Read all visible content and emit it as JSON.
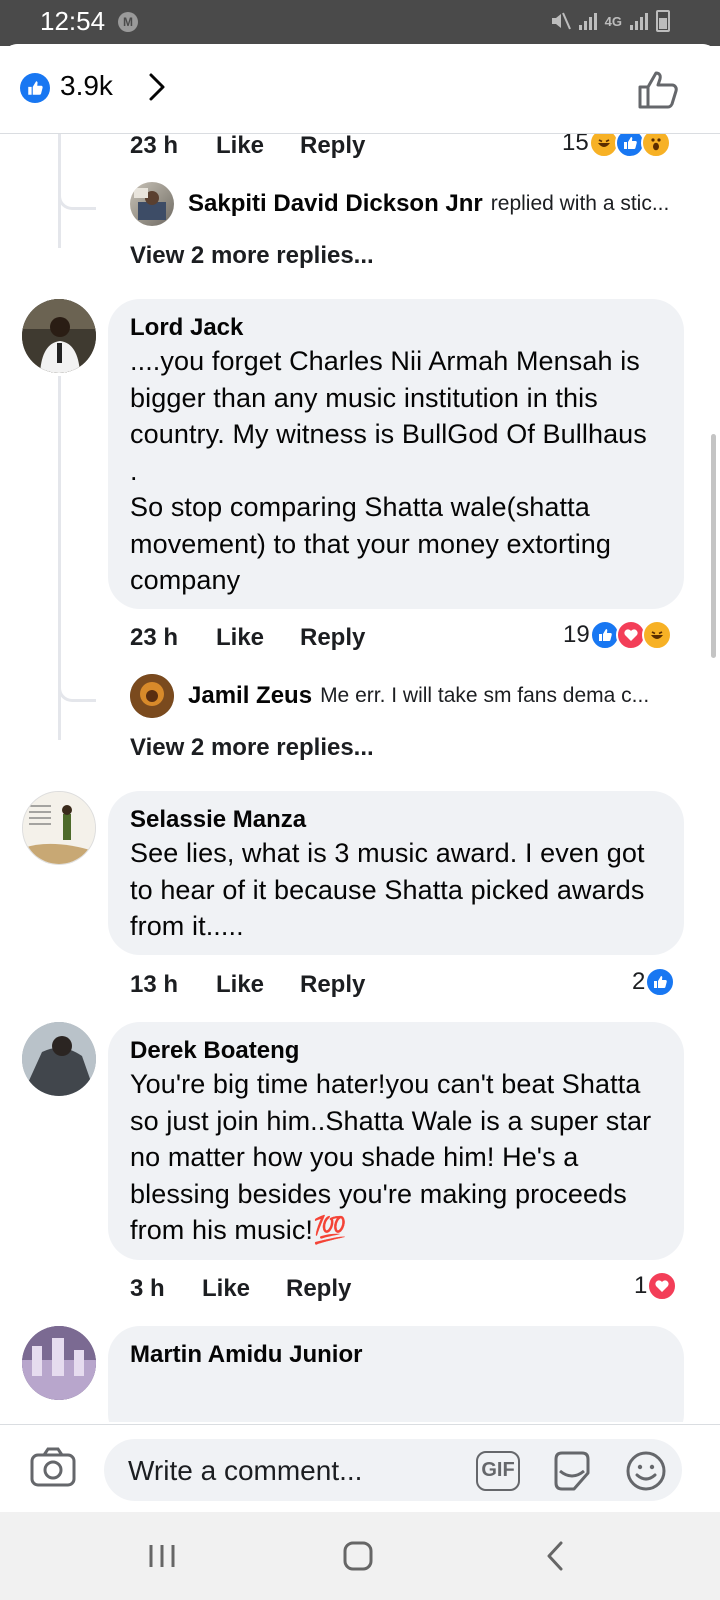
{
  "status_bar": {
    "time": "12:54",
    "notification_badge": "M",
    "network_label": "4G"
  },
  "header": {
    "like_count": "3.9k"
  },
  "thread_top": {
    "time": "23 h",
    "like_label": "Like",
    "reply_label": "Reply",
    "reaction_count": "15",
    "reply_preview": {
      "name": "Sakpiti David Dickson Jnr",
      "text": "replied with a stic..."
    },
    "view_more": "View 2 more replies..."
  },
  "comments": [
    {
      "name": "Lord Jack",
      "text": "....you forget Charles Nii Armah Mensah is bigger than any music institution in this country. My witness is BullGod Of Bullhaus .\nSo stop comparing Shatta wale(shatta movement) to that your money extorting company",
      "time": "23 h",
      "like_label": "Like",
      "reply_label": "Reply",
      "reaction_count": "19",
      "reply_preview": {
        "name": "Jamil Zeus",
        "text": "Me err. I will take sm fans dema c..."
      },
      "view_more": "View 2 more replies..."
    },
    {
      "name": "Selassie Manza",
      "text": "See lies, what is 3 music award. I even got to hear of it because Shatta picked awards from it.....",
      "time": "13 h",
      "like_label": "Like",
      "reply_label": "Reply",
      "reaction_count": "2"
    },
    {
      "name": "Derek Boateng",
      "text": "You're big time hater!you can't beat Shatta so just join him..Shatta Wale is a super star no matter how you shade him! He's a blessing besides you're making proceeds from his music!💯",
      "time": "3 h",
      "like_label": "Like",
      "reply_label": "Reply",
      "reaction_count": "1"
    },
    {
      "name": "Martin Amidu Junior"
    }
  ],
  "composer": {
    "placeholder": "Write a comment...",
    "gif_label": "GIF"
  },
  "colors": {
    "facebook_blue": "#1877f2",
    "love_red": "#f33e58",
    "haha_yellow": "#f7b125",
    "bubble_gray": "#f0f2f5"
  }
}
